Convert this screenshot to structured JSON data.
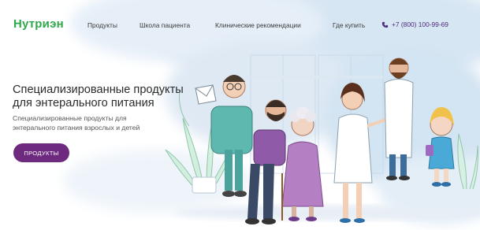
{
  "header": {
    "logo": "Нутриэн",
    "nav": [
      "Продукты",
      "Школа пациента",
      "Клинические рекомендации",
      "Где купить"
    ],
    "phone": "+7 (800) 100-99-69"
  },
  "hero": {
    "title_lines": [
      "Специализированные продукты",
      "для энтерального питания"
    ],
    "subtitle_lines": [
      "Специализированные продукты для",
      "энтерального питания взрослых и детей"
    ],
    "cta": "ПРОДУКТЫ"
  },
  "colors": {
    "logo": "#2fa84a",
    "cta_background": "#6e2a7e",
    "phone": "#4c2a7a",
    "watercolor_blue": "#cfe3f2",
    "watercolor_green": "#c9ecd6"
  },
  "icons": [
    "phone-icon"
  ]
}
